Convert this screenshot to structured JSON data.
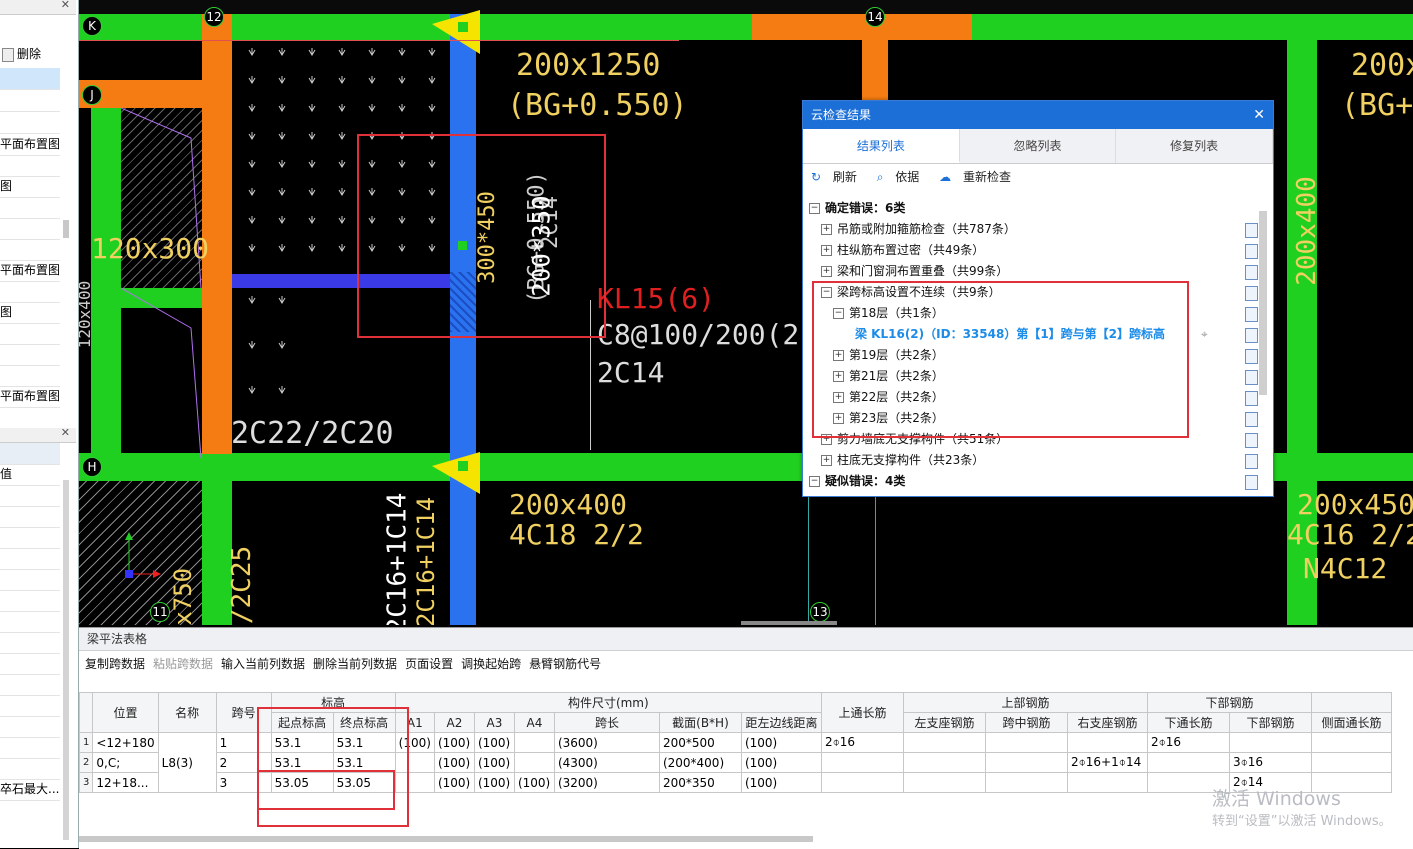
{
  "left_panel": {
    "top_button": "删除",
    "items": [
      "平面布置图",
      "图",
      "平面布置图",
      "图",
      "平面布置图"
    ],
    "lower_item": "值",
    "bottom_item": "卒石最大..."
  },
  "cad": {
    "axis_labels": [
      "K",
      "J",
      "H",
      "12",
      "14",
      "11",
      "13"
    ],
    "texts": {
      "beam1_size": "200x1250",
      "beam1_elev": "(BG+0.550)",
      "left_size": "120x300",
      "kl_name": "KL15(6)",
      "kl_stirrup": "C8@100/200(2)",
      "kl_top": "2C14",
      "rebar_2c22": "2C22/2C20",
      "rot_a": "300*450",
      "rot_b": "(BG+0.550)",
      "rot_c": "2C14",
      "rot_d": "200*350",
      "beam_200x400": "200x400",
      "beam_200x400_rebar": "4C18 2/2",
      "right_size_top": "200x1",
      "right_elev": "(BG+0",
      "right_vert": "200x400",
      "beam_200x450": "200x450",
      "beam_200x450_rebar": "4C16 2/2",
      "beam_200x450_side": "N4C12",
      "vert_2c16": "2C16+1C14",
      "vert_2c16b": "2C16+1C14",
      "vert_2c25": "/2C25",
      "vert_750": "0x750",
      "vert_left": "120x400"
    }
  },
  "dialog": {
    "title": "云检查结果",
    "tabs": [
      "结果列表",
      "忽略列表",
      "修复列表"
    ],
    "toolbar": {
      "refresh": "刷新",
      "basis": "依据",
      "recheck": "重新检查"
    },
    "tree": [
      {
        "level": 0,
        "sign": "−",
        "text": "确定错误：6类",
        "bold": true
      },
      {
        "level": 1,
        "sign": "+",
        "text": "吊筋或附加箍筋检查（共787条）"
      },
      {
        "level": 1,
        "sign": "+",
        "text": "柱纵筋布置过密（共49条）"
      },
      {
        "level": 1,
        "sign": "+",
        "text": "梁和门窗洞布置重叠（共99条）"
      },
      {
        "level": 1,
        "sign": "−",
        "text": "梁跨标高设置不连续（共9条）"
      },
      {
        "level": 2,
        "sign": "−",
        "text": "第18层（共1条）"
      },
      {
        "level": 3,
        "sign": "",
        "text": "梁 KL16(2)（ID：33548）第【1】跨与第【2】跨标高",
        "link": true
      },
      {
        "level": 2,
        "sign": "+",
        "text": "第19层（共2条）"
      },
      {
        "level": 2,
        "sign": "+",
        "text": "第21层（共2条）"
      },
      {
        "level": 2,
        "sign": "+",
        "text": "第22层（共2条）"
      },
      {
        "level": 2,
        "sign": "+",
        "text": "第23层（共2条）"
      },
      {
        "level": 1,
        "sign": "+",
        "text": "剪力墙底无支撑构件（共51条）"
      },
      {
        "level": 1,
        "sign": "+",
        "text": "柱底无支撑构件（共23条）"
      },
      {
        "level": 0,
        "sign": "−",
        "text": "疑似错误：4类",
        "bold": true
      }
    ]
  },
  "bottom": {
    "title": "梁平法表格",
    "toolbar": [
      {
        "label": "复制跨数据",
        "disabled": false
      },
      {
        "label": "粘贴跨数据",
        "disabled": true
      },
      {
        "label": "输入当前列数据",
        "disabled": false
      },
      {
        "label": "删除当前列数据",
        "disabled": false
      },
      {
        "label": "页面设置",
        "disabled": false
      },
      {
        "label": "调换起始跨",
        "disabled": false
      },
      {
        "label": "悬臂钢筋代号",
        "disabled": false
      }
    ],
    "group_headers": [
      "标高",
      "构件尺寸(mm)",
      "上部钢筋",
      "下部钢筋"
    ],
    "headers": [
      "位置",
      "名称",
      "跨号",
      "起点标高",
      "终点标高",
      "A1",
      "A2",
      "A3",
      "A4",
      "跨长",
      "截面(B*H)",
      "距左边线距离",
      "上通长筋",
      "左支座钢筋",
      "跨中钢筋",
      "右支座钢筋",
      "下通长筋",
      "下部钢筋",
      "侧面通长筋"
    ],
    "rows": [
      [
        "1",
        "<12+180",
        "L8(3)",
        "1",
        "53.1",
        "53.1",
        "(100)",
        "(100)",
        "(100)",
        "",
        "(3600)",
        "200*500",
        "(100)",
        "2⌽16",
        "",
        "",
        "",
        "2⌽16",
        "",
        ""
      ],
      [
        "2",
        "0,C;",
        "",
        "2",
        "53.1",
        "53.1",
        "",
        "(100)",
        "(100)",
        "",
        "(4300)",
        "(200*400)",
        "(100)",
        "",
        "",
        "",
        "2⌽16+1⌽14",
        "",
        "3⌽16",
        ""
      ],
      [
        "3",
        "12+18...",
        "",
        "3",
        "53.05",
        "53.05",
        "",
        "(100)",
        "(100)",
        "(100)",
        "(3200)",
        "200*350",
        "(100)",
        "",
        "",
        "",
        "",
        "",
        "2⌽14",
        ""
      ]
    ]
  },
  "watermark": {
    "line1": "激活 Windows",
    "line2": "转到“设置”以激活 Windows。"
  }
}
